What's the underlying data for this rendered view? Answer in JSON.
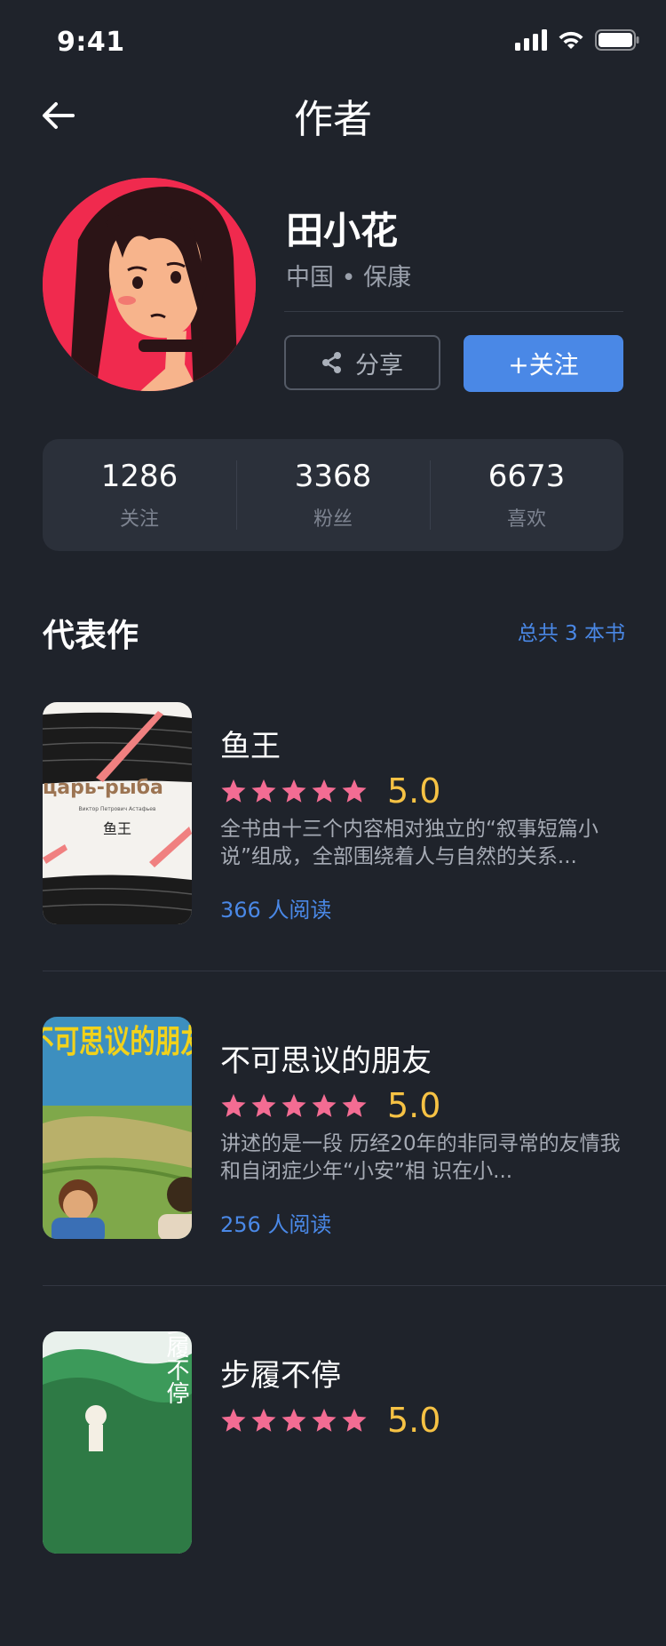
{
  "status_bar": {
    "time": "9:41"
  },
  "nav": {
    "title": "作者"
  },
  "author": {
    "name": "田小花",
    "location": "中国 • 保康",
    "share_label": "分享",
    "follow_label": "+关注"
  },
  "stats": [
    {
      "value": "1286",
      "label": "关注"
    },
    {
      "value": "3368",
      "label": "粉丝"
    },
    {
      "value": "6673",
      "label": "喜欢"
    }
  ],
  "section": {
    "title": "代表作",
    "count": "总共 3 本书"
  },
  "books": [
    {
      "title": "鱼王",
      "stars": 5,
      "score": "5.0",
      "desc": "全书由十三个内容相对独立的“叙事短篇小说”组成，全部围绕着人与自然的关系...",
      "reads": "366 人阅读",
      "cover_text": "царь-рыба",
      "cover_author": "Виктор Петрович Астафьев",
      "cover_cn": "鱼王"
    },
    {
      "title": "不可思议的朋友",
      "stars": 5,
      "score": "5.0",
      "desc": "讲述的是一段 历经20年的非同寻常的友情我和自闭症少年“小安”相 识在小...",
      "reads": "256 人阅读",
      "cover_text": "不可思议的朋友"
    },
    {
      "title": "步履不停",
      "stars": 5,
      "score": "5.0",
      "desc": "",
      "reads": "",
      "cover_text": "步履不停"
    }
  ],
  "colors": {
    "background": "#1f232b",
    "accent": "#4a88e6",
    "star": "#f36c93",
    "score": "#f6c244",
    "card": "#2b303a"
  }
}
